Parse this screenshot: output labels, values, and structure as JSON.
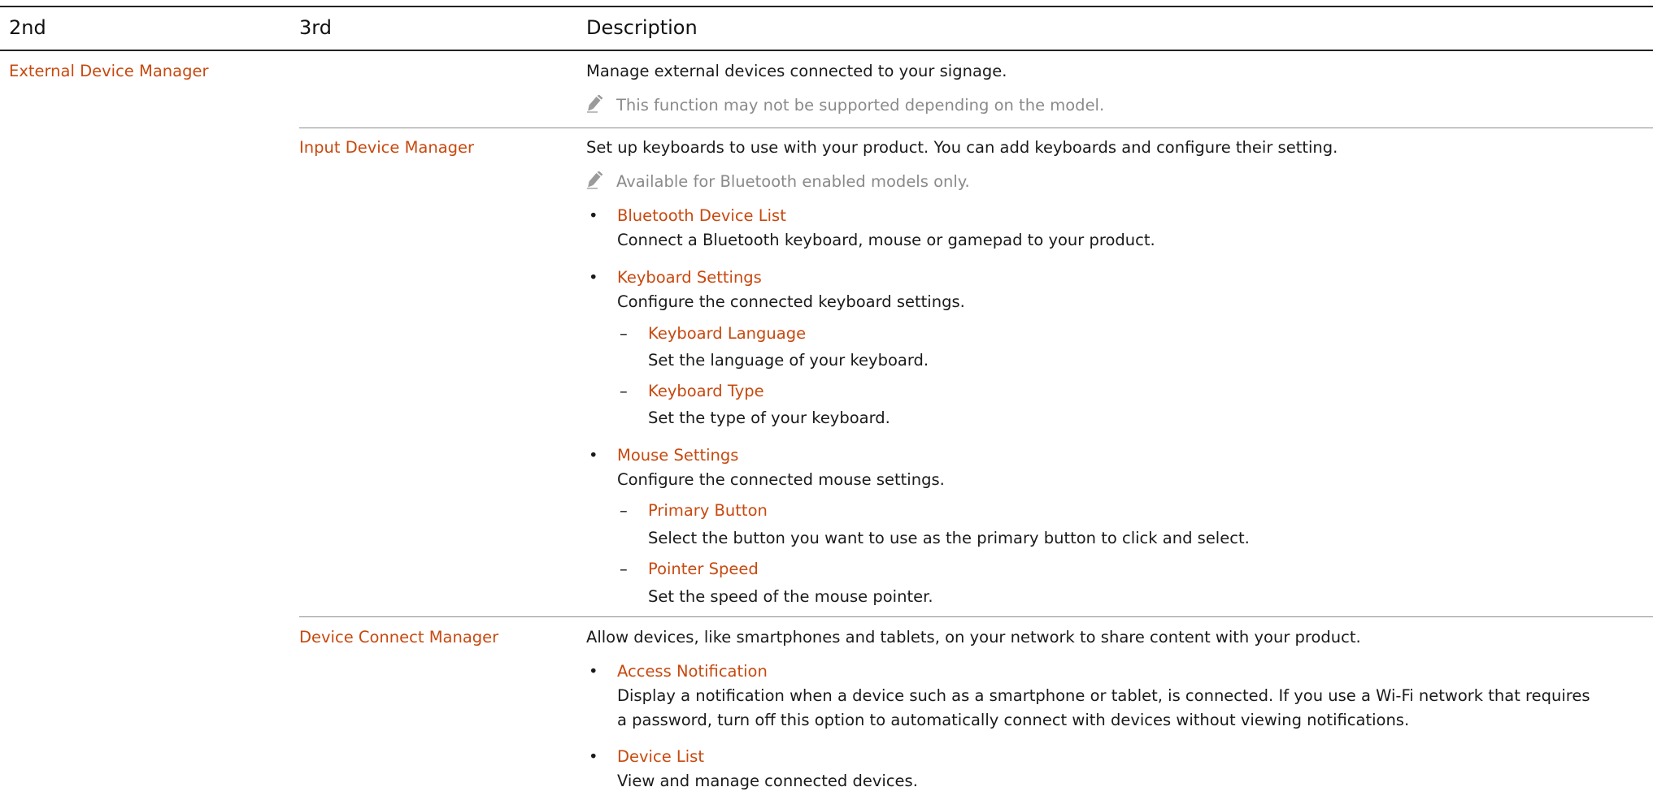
{
  "header": {
    "col1": "2nd",
    "col2": "3rd",
    "col3": "Description"
  },
  "external_device_manager": {
    "label": "External Device Manager",
    "description": "Manage external devices connected to your signage.",
    "note": "This function may not be supported depending on the model."
  },
  "input_device_manager": {
    "label": "Input Device Manager",
    "description": "Set up keyboards to use with your product. You can add keyboards and configure their setting.",
    "note": "Available for Bluetooth enabled models only.",
    "items": [
      {
        "title": "Bluetooth Device List",
        "desc": "Connect a Bluetooth keyboard, mouse or gamepad to your product."
      },
      {
        "title": "Keyboard Settings",
        "desc": "Configure the connected keyboard settings.",
        "subitems": [
          {
            "title": "Keyboard Language",
            "desc": "Set the language of your keyboard."
          },
          {
            "title": "Keyboard Type",
            "desc": "Set the type of your keyboard."
          }
        ]
      },
      {
        "title": "Mouse Settings",
        "desc": "Configure the connected mouse settings.",
        "subitems": [
          {
            "title": "Primary Button",
            "desc": "Select the button you want to use as the primary button to click and select."
          },
          {
            "title": "Pointer Speed",
            "desc": "Set the speed of the mouse pointer."
          }
        ]
      }
    ]
  },
  "device_connect_manager": {
    "label": "Device Connect Manager",
    "description": "Allow devices, like smartphones and tablets, on your network to share content with your product.",
    "items": [
      {
        "title": "Access Notification",
        "desc_line1": "Display a notification when a device such as a smartphone or tablet, is connected. If you use a Wi-Fi network that requires",
        "desc_line2": "a password, turn off this option to automatically connect with devices without viewing notifications."
      },
      {
        "title": "Device List",
        "desc": "View and manage connected devices."
      }
    ]
  },
  "symbols": {
    "bullet": "•",
    "dash": "–"
  },
  "icons": {
    "note": "pencil-note-icon"
  },
  "colors": {
    "accent": "#c8490f",
    "note_text": "#8a8a8a",
    "rule": "#222222",
    "thin_rule": "#8c8c8c"
  }
}
